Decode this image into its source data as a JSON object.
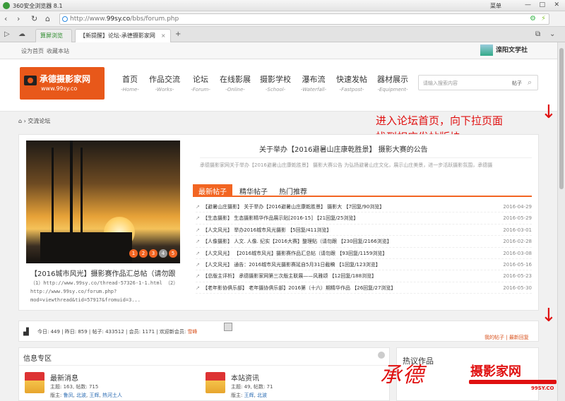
{
  "browser": {
    "title": "360安全浏览器 8.1",
    "menu": "菜单",
    "url_prefix": "http://www.",
    "url_domain": "99sy.co",
    "url_path": "/bbs/forum.php",
    "tabs": [
      {
        "label": "算屏浏览"
      },
      {
        "label": "【新提醒】论坛-承德摄影家网"
      }
    ]
  },
  "topbar": {
    "set_home": "设为首页",
    "favorite": "收藏本站",
    "brand": "滦阳文学社"
  },
  "site": {
    "logo_name": "承德摄影家网",
    "logo_url": "www.99sy.co",
    "nav": [
      {
        "zh": "首页",
        "en": "-Home-"
      },
      {
        "zh": "作品交流",
        "en": "-Works-"
      },
      {
        "zh": "论坛",
        "en": "-Forum-"
      },
      {
        "zh": "在线影展",
        "en": "-Online-"
      },
      {
        "zh": "摄影学校",
        "en": "-School-"
      },
      {
        "zh": "瀑布流",
        "en": "-Waterfall-"
      },
      {
        "zh": "快速发帖",
        "en": "-Fastpost-"
      },
      {
        "zh": "器材展示",
        "en": "-Equipment-"
      }
    ],
    "search_placeholder": "请输入搜索内容",
    "search_scope": "帖子"
  },
  "breadcrumb": "交流论坛",
  "annotation": {
    "line1": "进入论坛首页，向下拉页面",
    "line2": "找到相应发帖版块"
  },
  "featured": {
    "caption": "【2016城市风光】摄影赛作品汇总帖（请勿跟",
    "link_lines": [
      "（1）http://www.99sy.co/thread-57326-1-1.html （2）",
      "http://www.99sy.co/forum.php?",
      "mod=viewthread&tid=57917&fromuid=3..."
    ],
    "pager": [
      "1",
      "2",
      "3",
      "4",
      "5"
    ]
  },
  "announcement": {
    "title": "关于举办【2016避暑山庄康乾胜景】 摄影大赛的公告",
    "sub": "承德摄影家网关于举办【2016避暑山庄康乾胜景】 摄影大赛公告          为弘扬避暑山庄文化，展示山庄美景，进一步活跃摄影氛围，承德摄"
  },
  "post_tabs": [
    "最新帖子",
    "精华帖子",
    "热门推荐"
  ],
  "posts": [
    {
      "text": "【避暑山庄摄影】 关于举办【2016避暑山庄康乾胜景】 摄影大 【7回复/90浏览】",
      "date": "2016-04-29"
    },
    {
      "text": "【生态摄影】 生态摄影精华作品展示贴[2016-15] 【21回复/25浏览】",
      "date": "2016-05-29"
    },
    {
      "text": "【人文风光】 举办2016城市风光摄影 【5回复/411浏览】",
      "date": "2016-03-01"
    },
    {
      "text": "【人像摄影】 人文. 人像. 纪实【2016大赛】整理贴（请勿跟 【230回复/2166浏览】",
      "date": "2016-02-28"
    },
    {
      "text": "【人文风光】 【2016城市风光】摄影赛作品汇总帖（请勿跟 【93回复/1159浏览】",
      "date": "2016-03-08"
    },
    {
      "text": "【人文风光】 通告：2016城市风光摄影赛延自5月31日截稿 【1回复/123浏览】",
      "date": "2016-05-16"
    },
    {
      "text": "【总版主评析】 承德摄影家网第三次版主联展——风雅颂 【12回复/188浏览】",
      "date": "2016-05-23"
    },
    {
      "text": "【老年影协俱乐部】 老年摄协俱乐部】2016第（十六）期精华作品 【26回复/27浏览】",
      "date": "2016-05-30"
    }
  ],
  "stats": {
    "text": "今日: 449 | 昨日: 859 | 帖子: 433512 | 会员: 1171 | 欢迎新会员: ",
    "new_member": "雪峰",
    "my_posts": "我的帖子",
    "latest": "最新回复"
  },
  "info": {
    "header": "信息专区",
    "forums": [
      {
        "title": "最新消息",
        "line1": "主题: 163, 帖数: 715",
        "line2_prefix": "版主: ",
        "mods": [
          "鲁凤",
          "北波",
          "王辉",
          "热河土人"
        ]
      },
      {
        "title": "本站资讯",
        "line1": "主题: 49, 帖数: 71",
        "line2_prefix": "版主: ",
        "mods": [
          "王辉",
          "北波"
        ]
      }
    ]
  },
  "hot": {
    "header": "热议作品"
  },
  "watermark": {
    "left": "承德",
    "right": "摄影家网",
    "url": "99SY.CO"
  },
  "colors": {
    "accent": "#f26522",
    "annotation": "#e01010"
  }
}
